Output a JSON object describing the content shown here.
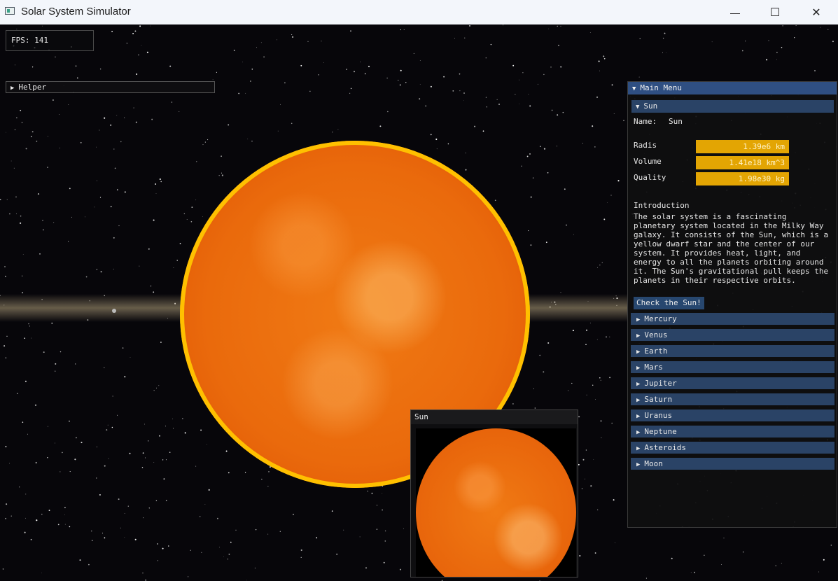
{
  "window": {
    "title": "Solar System Simulator",
    "minimize_glyph": "—",
    "maximize_glyph": "☐",
    "close_glyph": "✕"
  },
  "overlay": {
    "fps_text": "FPS: 141",
    "helper_label": "Helper"
  },
  "main_menu": {
    "header": "Main Menu",
    "expanded_section": "Sun",
    "name_label": "Name:",
    "name_value": "Sun",
    "properties": [
      {
        "label": "Radis",
        "value": "1.39e6 km"
      },
      {
        "label": "Volume",
        "value": "1.41e18 km^3"
      },
      {
        "label": "Quality",
        "value": "1.98e30 kg"
      }
    ],
    "intro_title": "Introduction",
    "intro_text": "The solar system is a fascinating planetary system located in the Milky Way galaxy. It consists of the Sun, which is a yellow dwarf star and the center of our system. It provides heat, light, and energy to all the planets orbiting around it. The Sun's gravitational pull keeps the planets in their respective orbits.",
    "check_button": "Check the Sun!",
    "collapsed_sections": [
      "Mercury",
      "Venus",
      "Earth",
      "Mars",
      "Jupiter",
      "Saturn",
      "Uranus",
      "Neptune",
      "Asteroids",
      "Moon"
    ]
  },
  "preview_window": {
    "title": "Sun"
  },
  "colors": {
    "menu_header": "#2f4f82",
    "section": "#2a4366",
    "value_box": "#e3a503",
    "sun_rim": "#ffc000"
  }
}
